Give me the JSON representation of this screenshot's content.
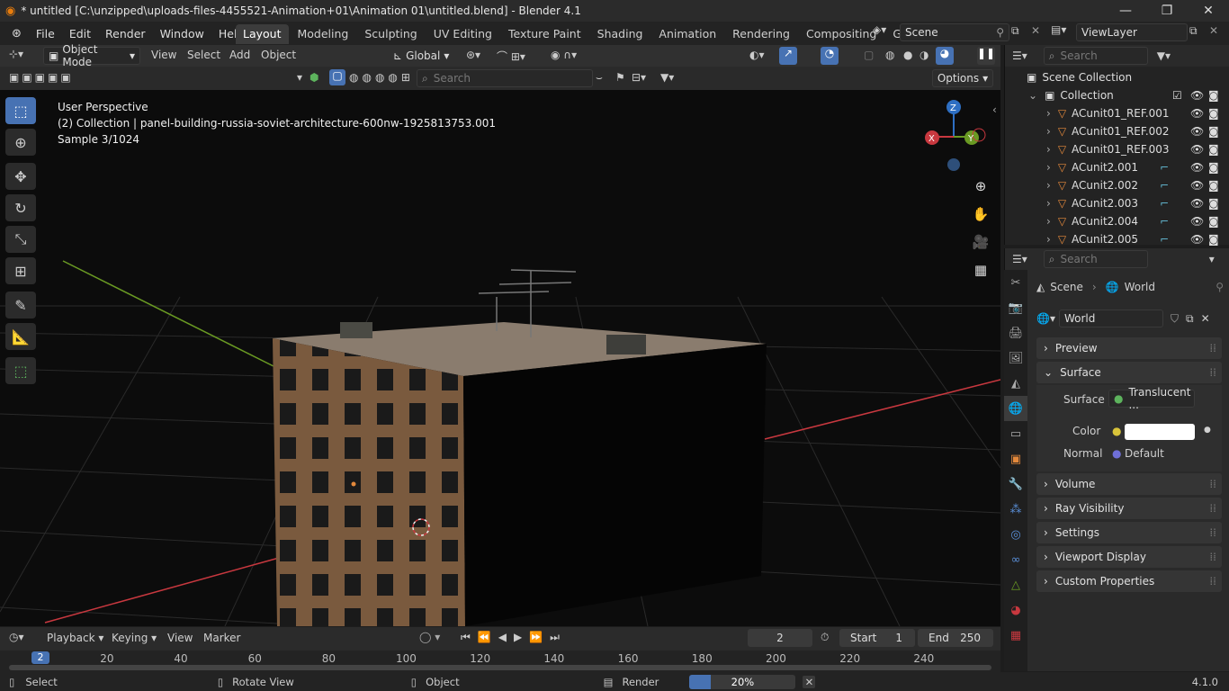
{
  "window": {
    "title": "* untitled [C:\\unzipped\\uploads-files-4455521-Animation+01\\Animation 01\\untitled.blend] - Blender 4.1",
    "controls": [
      "—",
      "❐",
      "✕"
    ]
  },
  "menu": [
    "File",
    "Edit",
    "Render",
    "Window",
    "Help"
  ],
  "workspaces": [
    "Layout",
    "Modeling",
    "Sculpting",
    "UV Editing",
    "Texture Paint",
    "Shading",
    "Animation",
    "Rendering",
    "Compositing",
    "Geomet"
  ],
  "active_workspace": "Layout",
  "scene_name": "Scene",
  "view_layer": "ViewLayer",
  "viewport_header": {
    "mode": "Object Mode",
    "menus": [
      "View",
      "Select",
      "Add",
      "Object"
    ],
    "transform_orientation": "Global",
    "search_placeholder": "Search",
    "options": "Options"
  },
  "viewport_info": {
    "line1": "User Perspective",
    "line2": "(2) Collection | panel-building-russia-soviet-architecture-600nw-1925813753.001",
    "line3": "Sample 3/1024"
  },
  "gizmo": {
    "x": "X",
    "y": "Y",
    "z": "Z"
  },
  "outliner": {
    "search_placeholder": "Search",
    "root": "Scene Collection",
    "collection": "Collection",
    "items": [
      {
        "name": "ACunit01_REF.001",
        "mod": false
      },
      {
        "name": "ACunit01_REF.002",
        "mod": false
      },
      {
        "name": "ACunit01_REF.003",
        "mod": false
      },
      {
        "name": "ACunit2.001",
        "mod": true
      },
      {
        "name": "ACunit2.002",
        "mod": true
      },
      {
        "name": "ACunit2.003",
        "mod": true
      },
      {
        "name": "ACunit2.004",
        "mod": true
      },
      {
        "name": "ACunit2.005",
        "mod": true
      }
    ]
  },
  "properties": {
    "search_placeholder": "Search",
    "breadcrumb": [
      "Scene",
      "World"
    ],
    "world_name": "World",
    "panels": {
      "preview": "Preview",
      "surface": "Surface",
      "volume": "Volume",
      "ray_visibility": "Ray Visibility",
      "settings": "Settings",
      "viewport_display": "Viewport Display",
      "custom_properties": "Custom Properties"
    },
    "surface_label": "Surface",
    "surface_value": "Translucent ...",
    "color_label": "Color",
    "normal_label": "Normal",
    "normal_value": "Default",
    "color_value": "#ffffff"
  },
  "timeline": {
    "menus": [
      "Playback",
      "Keying",
      "View",
      "Marker"
    ],
    "current_frame": "2",
    "start_label": "Start",
    "start": "1",
    "end_label": "End",
    "end": "250",
    "ticks": [
      "20",
      "40",
      "60",
      "80",
      "100",
      "120",
      "140",
      "160",
      "180",
      "200",
      "220",
      "240"
    ],
    "playhead": "2"
  },
  "statusbar": {
    "select": "Select",
    "rotate": "Rotate View",
    "object": "Object",
    "render": "Render",
    "progress": "20%",
    "progress_fraction": 0.2,
    "version": "4.1.0"
  },
  "colors": {
    "accent": "#4772b3",
    "outliner_icon": "#e3883b",
    "x_axis": "#c8383f",
    "y_axis": "#6a9a23",
    "z_axis": "#2e6fc3"
  }
}
